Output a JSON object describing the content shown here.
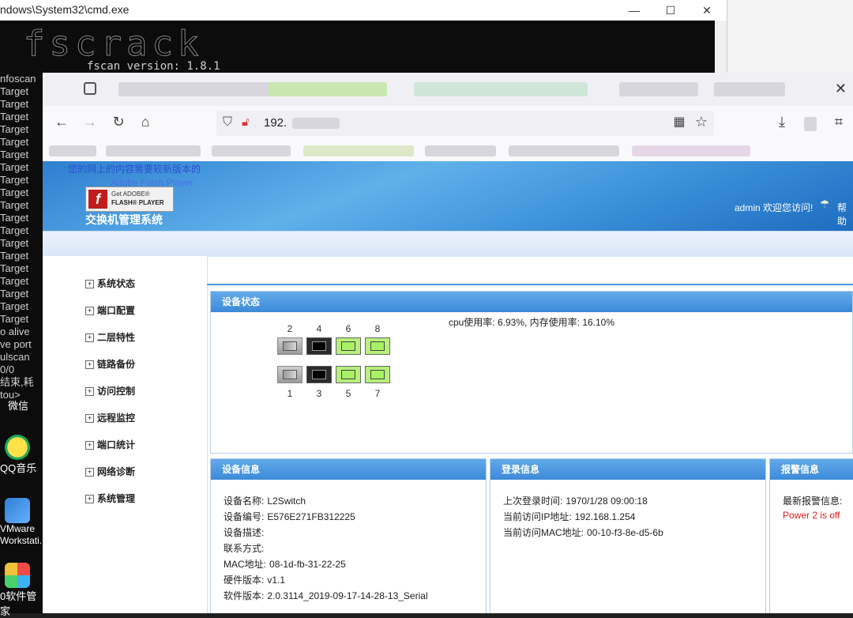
{
  "cmd": {
    "title": "ndows\\System32\\cmd.exe",
    "banner": "fscrack",
    "version_line": "fscan version: 1.8.1",
    "lines": [
      "nfoscan",
      "Target",
      "Target",
      "Target",
      "Target",
      "Target",
      "Target",
      "Target",
      "Target",
      "Target",
      "Target",
      "Target",
      "Target",
      "Target",
      "Target",
      "Target",
      "Target",
      "Target",
      "Target",
      "Target",
      "o alive",
      "ve port",
      "ulscan",
      "0/0",
      "结束,耗",
      "tou>"
    ],
    "controls": {
      "minimize": "—",
      "maximize": "☐",
      "close": "✕"
    }
  },
  "desktop": {
    "icons": [
      {
        "label": "微信"
      },
      {
        "label": "QQ音乐"
      },
      {
        "label": "VMware Workstati..."
      },
      {
        "label": "0软件管家"
      }
    ]
  },
  "browser": {
    "tab_close": "✕",
    "url": "192.",
    "nav": {
      "back": "←",
      "forward": "→",
      "reload": "↻",
      "home": "⌂",
      "qr": "▦",
      "star": "☆",
      "download": "⤓",
      "crop": "⌗"
    }
  },
  "switch": {
    "flash_notice": "您的网上的内容需要较新版本的",
    "flash_notice2": "Adobe Flash Player",
    "flash_get": "Get ADOBE®",
    "flash_player": "FLASH® PLAYER",
    "system_title": "交换机管理系统",
    "admin_welcome": "admin 欢迎您访问!",
    "help": "帮助",
    "menu": [
      "系统状态",
      "端口配置",
      "二层特性",
      "链路备份",
      "访问控制",
      "远程监控",
      "端口统计",
      "网络诊断",
      "系统管理"
    ],
    "device_status": {
      "title": "设备状态",
      "usage": "cpu使用率: 6.93%, 内存使用率: 16.10%",
      "ports_top": [
        {
          "num": "2",
          "state": "down"
        },
        {
          "num": "4",
          "state": "black"
        },
        {
          "num": "6",
          "state": "green"
        },
        {
          "num": "8",
          "state": "green"
        }
      ],
      "ports_bottom": [
        {
          "num": "1",
          "state": "down"
        },
        {
          "num": "3",
          "state": "black"
        },
        {
          "num": "5",
          "state": "green"
        },
        {
          "num": "7",
          "state": "green"
        }
      ]
    },
    "device_info": {
      "title": "设备信息",
      "rows": [
        {
          "label": "设备名称:",
          "value": "L2Switch"
        },
        {
          "label": "设备编号:",
          "value": "E576E271FB312225"
        },
        {
          "label": "设备描述:",
          "value": ""
        },
        {
          "label": "联系方式:",
          "value": ""
        },
        {
          "label": "MAC地址:",
          "value": "08-1d-fb-31-22-25"
        },
        {
          "label": "硬件版本:",
          "value": "v1.1"
        },
        {
          "label": "软件版本:",
          "value": "2.0.3114_2019-09-17-14-28-13_Serial"
        }
      ]
    },
    "login_info": {
      "title": "登录信息",
      "rows": [
        {
          "label": "上次登录时间:",
          "value": "1970/1/28 09:00:18"
        },
        {
          "label": "当前访问IP地址:",
          "value": "192.168.1.254"
        },
        {
          "label": "当前访问MAC地址:",
          "value": "00-10-f3-8e-d5-6b"
        }
      ]
    },
    "alarm_info": {
      "title": "报警信息",
      "latest_label": "最新报警信息:",
      "latest_value": "Power 2 is off",
      "alert_color": "#e21b1b"
    }
  }
}
